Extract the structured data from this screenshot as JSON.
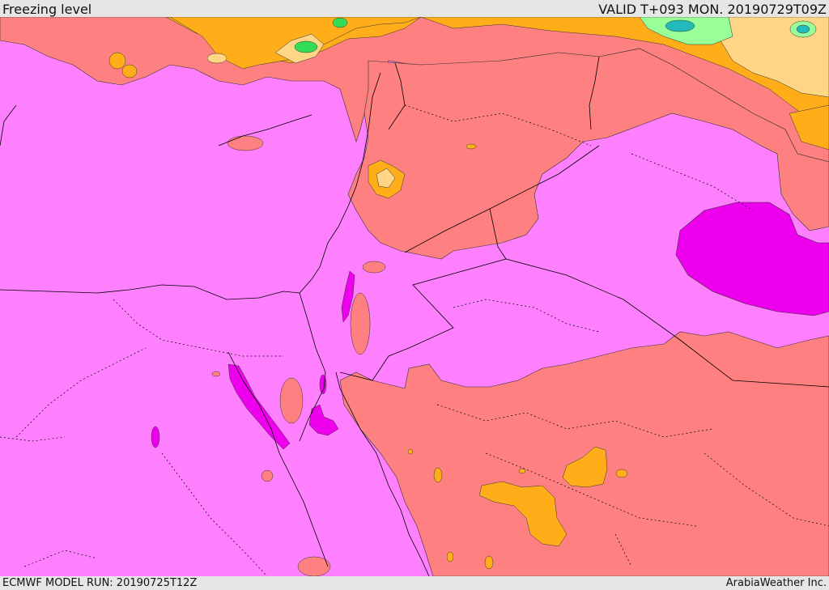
{
  "header": {
    "title": "Freezing level",
    "valid": "VALID T+093 MON. 20190729T09Z"
  },
  "footer": {
    "model_run": "ECMWF MODEL RUN: 20190725T12Z",
    "credit": "ArabiaWeather Inc."
  },
  "map": {
    "colors": {
      "level_base": "#ff80ff",
      "level_high": "#ee00ee",
      "level_mid": "#ff8080",
      "level_low1": "#ffae1a",
      "level_low2": "#ffd685",
      "level_low3": "#99ff99",
      "level_low4": "#33dd55",
      "level_low5": "#22bbbb",
      "border": "#000000"
    }
  }
}
